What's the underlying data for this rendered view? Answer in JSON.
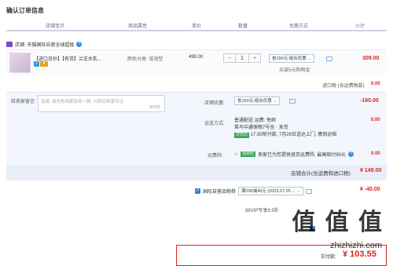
{
  "page_title": "确认订单信息",
  "columns": [
    "店铺宝贝",
    "商品属性",
    "单价",
    "数量",
    "优惠方式",
    "小计"
  ],
  "store": {
    "name": "店铺: 天猫国际自营全球超级"
  },
  "item": {
    "name": "【进口日抄】【有货】兰芝水乳...",
    "attr": "颜色分类: 滋润型",
    "price": "499.00",
    "qty": "1",
    "minus": "−",
    "plus": "+",
    "promo_select": "省190元:组合优惠",
    "promo_note": "买返5元购物金",
    "subtotal": "309.00"
  },
  "import_tax": {
    "label": "进口税 (含运费税款)",
    "value": "0.00"
  },
  "message": {
    "label": "给卖家留言:",
    "placeholder": "选填, 请先和商家协商一致, 付款后商家可见",
    "counter": "0/200"
  },
  "store_discount": {
    "label": "店铺优惠:",
    "select": "省160元:组合优惠",
    "value": "-160.00"
  },
  "shipping": {
    "label": "运送方式:",
    "line1": "普通配送 运费: 免邮",
    "line2": "菜鸟中通保税7号仓 · 发货",
    "tag": "次日达",
    "line3": "17:30前付款, 7月26日送达上门, 晚到必赔",
    "value": "0.00"
  },
  "insurance": {
    "label": "运费险:",
    "tag": "运费险",
    "text": "卖家已为您提供退货运费险, 最高赔付80元",
    "value": "0.00"
  },
  "store_total": {
    "label": "店铺合计(含运费和进口税)",
    "value": "¥ 149.00"
  },
  "platform": {
    "label": "国际自营品物券",
    "select": "满299减40元 (2023.07.25 ...",
    "value": "¥ -40.00"
  },
  "vip": {
    "label": "88VIP专享9.5折"
  },
  "pay": {
    "label": "实付款:",
    "value": "¥ 103.55"
  },
  "watermark": {
    "big": "值 值 值",
    "small": "zhizhizhi.com"
  }
}
